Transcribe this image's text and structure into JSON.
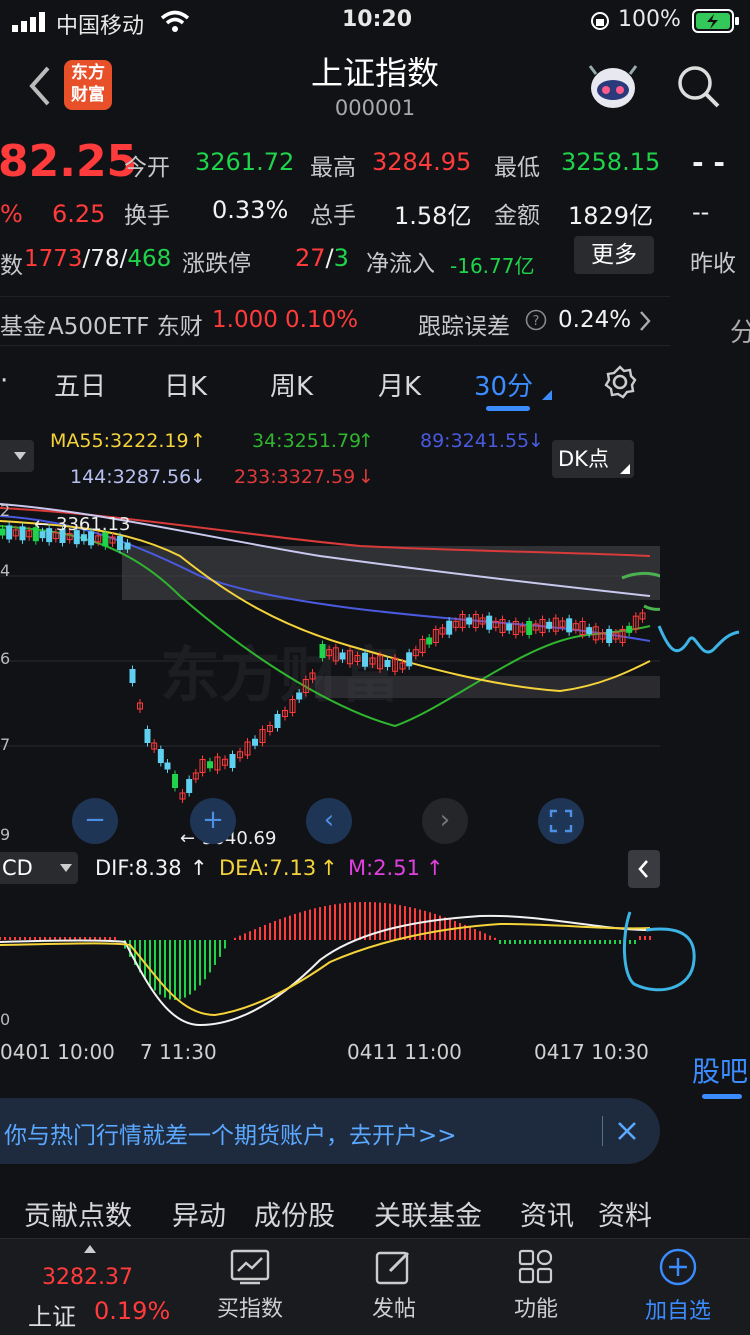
{
  "status": {
    "carrier": "中国移动",
    "time": "10:20",
    "battery": "100%"
  },
  "header": {
    "title": "上证指数",
    "code": "000001",
    "logo_line1": "东方",
    "logo_line2": "财富"
  },
  "quote": {
    "price": "82.25",
    "pct_fragment": "%",
    "change": "6.25",
    "open_label": "今开",
    "open": "3261.72",
    "high_label": "最高",
    "high": "3284.95",
    "low_label": "最低",
    "low": "3258.15",
    "turnover_label": "换手",
    "turnover": "0.33%",
    "volume_label": "总手",
    "volume": "1.58亿",
    "amount_label": "金额",
    "amount": "1829亿",
    "breadth_prefix": "数",
    "up": "1773",
    "flat": "78",
    "down": "468",
    "limit_label": "涨跌停",
    "limit_up": "27",
    "limit_down": "3",
    "netflow_label": "净流入",
    "netflow": "-16.77亿",
    "more": "更多",
    "right_dash1": "- -",
    "right_dash2": "--",
    "right_prev": "昨收"
  },
  "fund": {
    "prefix": "基金",
    "name": "A500ETF 东财",
    "nav": "1.000",
    "pct": "0.10%",
    "err_label": "跟踪误差",
    "err": "0.24%",
    "right_char": "分"
  },
  "tabs": {
    "partial": "·",
    "t1": "五日",
    "t2": "日K",
    "t3": "周K",
    "t4": "月K",
    "t5": "30分"
  },
  "ma": {
    "ma55": "MA55:3222.19",
    "ma34": "34:3251.79",
    "ma89": "89:3241.55",
    "ma144": "144:3287.56",
    "ma233": "233:3327.59",
    "dk": "DK点"
  },
  "chart": {
    "label_top": "3361.13",
    "label_bottom": "3040.69",
    "y_2": "2",
    "y_4": "4",
    "y_6": "6",
    "y_7": "7",
    "y_9": "9",
    "watermark": "东方财富"
  },
  "macd": {
    "name": "CD",
    "dif": "DIF:8.38",
    "dea": "DEA:7.13",
    "m": "M:2.51",
    "y0": "0"
  },
  "time_axis": {
    "t1": "0401 10:00",
    "t2": "7 11:30",
    "t3": "0411 11:00",
    "t4": "0417 10:30"
  },
  "guba": "股吧",
  "promo": {
    "text": "你与热门行情就差一个期货账户，去开户>>"
  },
  "bottom_tabs": {
    "b1": "贡献点数",
    "b2": "异动",
    "b3": "成份股",
    "b4": "关联基金",
    "b5": "资讯",
    "b6": "资料"
  },
  "tabbar": {
    "index_price": "3282.37",
    "index_name": "上证",
    "index_pct": "0.19%",
    "buy": "买指数",
    "post": "发帖",
    "func": "功能",
    "add": "加自选"
  },
  "colors": {
    "up": "#ff3b3b",
    "down": "#1fd34b",
    "accent": "#3a8cff",
    "ma55": "#f5d33a",
    "ma34": "#2fb52f",
    "ma89": "#4a5adf",
    "ma144": "#c9c9f0",
    "ma233": "#e03a3a"
  }
}
